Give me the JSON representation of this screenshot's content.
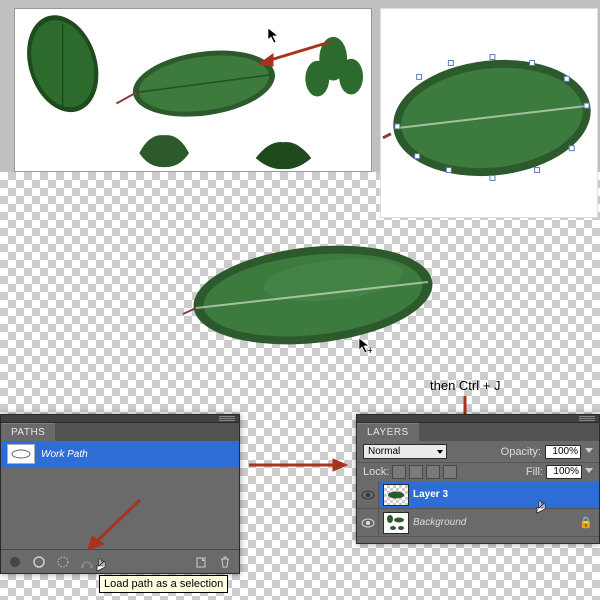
{
  "annotations": {
    "ctrl_j": "then Ctrl + J"
  },
  "tooltip": {
    "load_path": "Load path as a selection"
  },
  "paths_panel": {
    "title": "PATHS",
    "work_path": "Work Path"
  },
  "layers_panel": {
    "title": "LAYERS",
    "blend_mode": "Normal",
    "opacity_label": "Opacity:",
    "opacity_value": "100%",
    "lock_label": "Lock:",
    "fill_label": "Fill:",
    "fill_value": "100%",
    "layer3": "Layer 3",
    "background": "Background"
  }
}
